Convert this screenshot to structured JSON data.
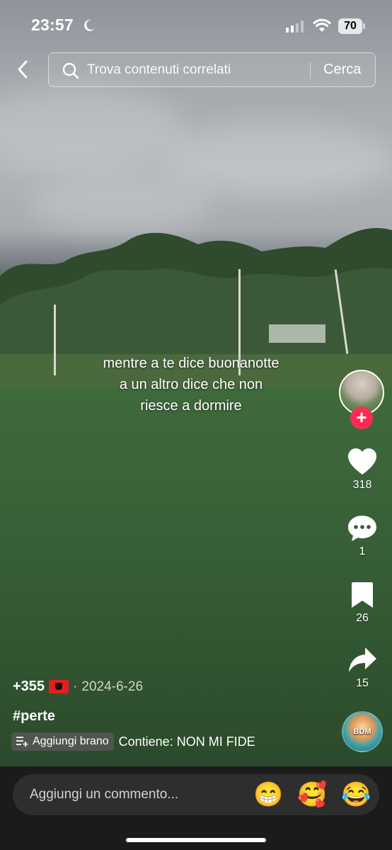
{
  "status_bar": {
    "time": "23:57",
    "battery": "70",
    "icons": [
      "moon-icon",
      "signal-icon",
      "wifi-icon",
      "battery-icon"
    ]
  },
  "search": {
    "placeholder": "Trova contenuti correlati",
    "button_label": "Cerca"
  },
  "video": {
    "caption_lines": [
      "mentre a te dice buonanotte",
      "a un altro dice che non",
      "riesce a dormire"
    ]
  },
  "actions": {
    "likes": "318",
    "comments": "1",
    "saves": "26",
    "shares": "15",
    "follow_symbol": "+",
    "music_disc_text": "BDM"
  },
  "post": {
    "author": "+355",
    "date_separator": "·",
    "date": "2024-6-26",
    "hashtag": "#perte",
    "add_song_label": "Aggiungi brano",
    "music_label": "Contiene: NON MI FIDE"
  },
  "comment_bar": {
    "placeholder": "Aggiungi un commento...",
    "emojis": [
      "😁",
      "🥰",
      "😂"
    ]
  },
  "colors": {
    "accent": "#fe2c55",
    "comment_bar_bg": "#1b1b1b",
    "comment_input_bg": "#2e2e2e"
  }
}
